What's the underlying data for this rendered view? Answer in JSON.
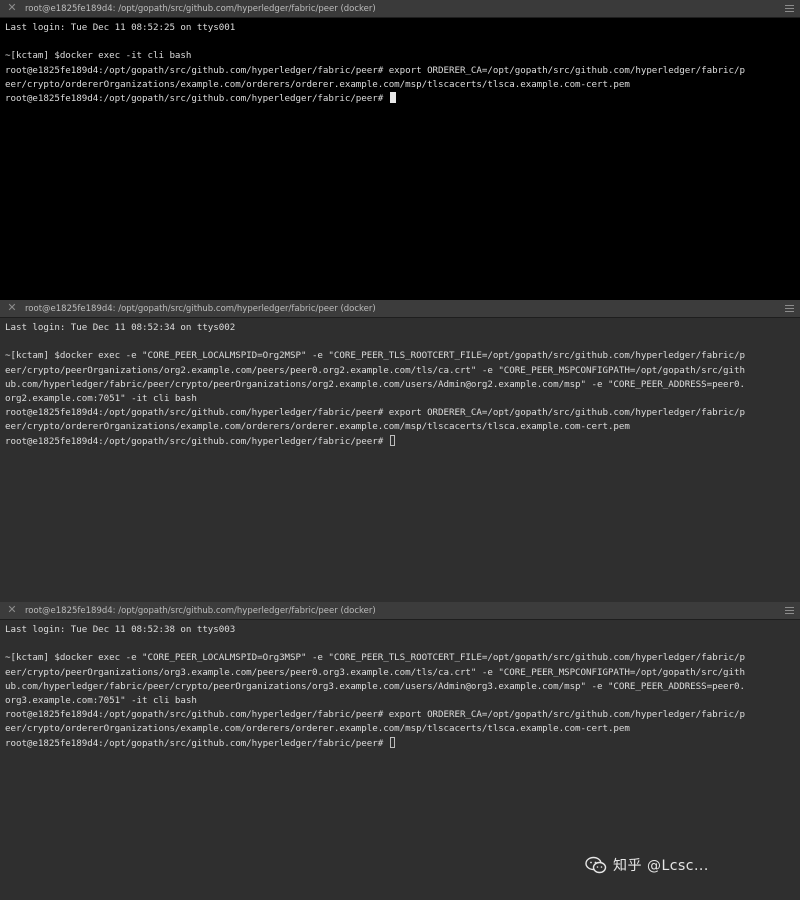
{
  "panes": [
    {
      "title": "root@e1825fe189d4: /opt/gopath/src/github.com/hyperledger/fabric/peer (docker)",
      "lines": [
        "Last login: Tue Dec 11 08:52:25 on ttys001",
        "",
        "~[kctam] $docker exec -it cli bash",
        "root@e1825fe189d4:/opt/gopath/src/github.com/hyperledger/fabric/peer# export ORDERER_CA=/opt/gopath/src/github.com/hyperledger/fabric/p",
        "eer/crypto/ordererOrganizations/example.com/orderers/orderer.example.com/msp/tlscacerts/tlsca.example.com-cert.pem"
      ],
      "prompt": "root@e1825fe189d4:/opt/gopath/src/github.com/hyperledger/fabric/peer# "
    },
    {
      "title": "root@e1825fe189d4: /opt/gopath/src/github.com/hyperledger/fabric/peer (docker)",
      "lines": [
        "Last login: Tue Dec 11 08:52:34 on ttys002",
        "",
        "~[kctam] $docker exec -e \"CORE_PEER_LOCALMSPID=Org2MSP\" -e \"CORE_PEER_TLS_ROOTCERT_FILE=/opt/gopath/src/github.com/hyperledger/fabric/p",
        "eer/crypto/peerOrganizations/org2.example.com/peers/peer0.org2.example.com/tls/ca.crt\" -e \"CORE_PEER_MSPCONFIGPATH=/opt/gopath/src/gith",
        "ub.com/hyperledger/fabric/peer/crypto/peerOrganizations/org2.example.com/users/Admin@org2.example.com/msp\" -e \"CORE_PEER_ADDRESS=peer0.",
        "org2.example.com:7051\" -it cli bash",
        "root@e1825fe189d4:/opt/gopath/src/github.com/hyperledger/fabric/peer# export ORDERER_CA=/opt/gopath/src/github.com/hyperledger/fabric/p",
        "eer/crypto/ordererOrganizations/example.com/orderers/orderer.example.com/msp/tlscacerts/tlsca.example.com-cert.pem"
      ],
      "prompt": "root@e1825fe189d4:/opt/gopath/src/github.com/hyperledger/fabric/peer# "
    },
    {
      "title": "root@e1825fe189d4: /opt/gopath/src/github.com/hyperledger/fabric/peer (docker)",
      "lines": [
        "Last login: Tue Dec 11 08:52:38 on ttys003",
        "",
        "~[kctam] $docker exec -e \"CORE_PEER_LOCALMSPID=Org3MSP\" -e \"CORE_PEER_TLS_ROOTCERT_FILE=/opt/gopath/src/github.com/hyperledger/fabric/p",
        "eer/crypto/peerOrganizations/org3.example.com/peers/peer0.org3.example.com/tls/ca.crt\" -e \"CORE_PEER_MSPCONFIGPATH=/opt/gopath/src/gith",
        "ub.com/hyperledger/fabric/peer/crypto/peerOrganizations/org3.example.com/users/Admin@org3.example.com/msp\" -e \"CORE_PEER_ADDRESS=peer0.",
        "org3.example.com:7051\" -it cli bash",
        "root@e1825fe189d4:/opt/gopath/src/github.com/hyperledger/fabric/peer# export ORDERER_CA=/opt/gopath/src/github.com/hyperledger/fabric/p",
        "eer/crypto/ordererOrganizations/example.com/orderers/orderer.example.com/msp/tlscacerts/tlsca.example.com-cert.pem"
      ],
      "prompt": "root@e1825fe189d4:/opt/gopath/src/github.com/hyperledger/fabric/peer# "
    }
  ],
  "icons": {
    "close": "close-icon",
    "menu": "hamburger-menu-icon",
    "watermark": "wechat-icon"
  },
  "colors": {
    "active_background": "#000000",
    "inactive_background": "#2f2f2f",
    "titlebar": "#3c3c3c",
    "text": "#dcdcdc"
  },
  "watermark": {
    "text": "知乎 @Lcsc..."
  }
}
